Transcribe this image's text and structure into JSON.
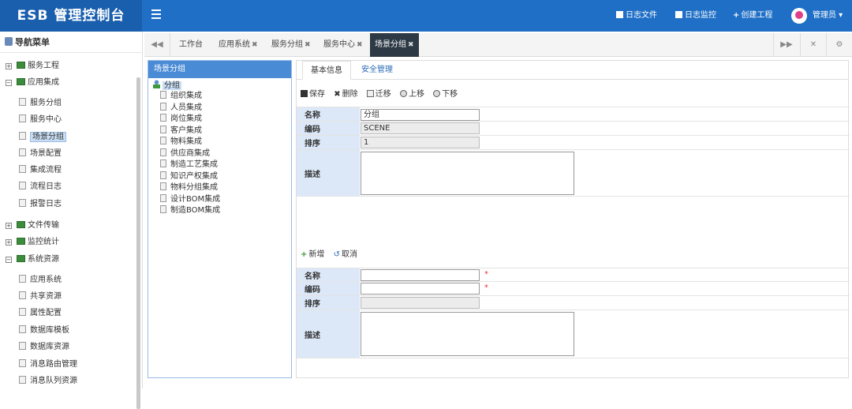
{
  "header": {
    "title": "ESB 管理控制台",
    "links": [
      "日志文件",
      "日志监控",
      "创建工程"
    ],
    "user": "管理员"
  },
  "sidebar": {
    "title": "导航菜单",
    "items": [
      {
        "label": "服务工程",
        "type": "group",
        "open": false
      },
      {
        "label": "应用集成",
        "type": "group",
        "open": true
      },
      {
        "label": "服务分组",
        "type": "leaf"
      },
      {
        "label": "服务中心",
        "type": "leaf"
      },
      {
        "label": "场景分组",
        "type": "leaf",
        "selected": true
      },
      {
        "label": "场景配置",
        "type": "leaf"
      },
      {
        "label": "集成流程",
        "type": "leaf"
      },
      {
        "label": "流程日志",
        "type": "leaf"
      },
      {
        "label": "报警日志",
        "type": "leaf"
      },
      {
        "label": "文件传输",
        "type": "group",
        "open": false
      },
      {
        "label": "监控统计",
        "type": "group",
        "open": false
      },
      {
        "label": "系统资源",
        "type": "group",
        "open": true
      },
      {
        "label": "应用系统",
        "type": "leaf"
      },
      {
        "label": "共享资源",
        "type": "leaf"
      },
      {
        "label": "属性配置",
        "type": "leaf"
      },
      {
        "label": "数据库模板",
        "type": "leaf"
      },
      {
        "label": "数据库资源",
        "type": "leaf"
      },
      {
        "label": "消息路由管理",
        "type": "leaf"
      },
      {
        "label": "消息队列资源",
        "type": "leaf"
      }
    ]
  },
  "tabs": [
    {
      "label": "工作台",
      "closable": false
    },
    {
      "label": "应用系统",
      "closable": true
    },
    {
      "label": "服务分组",
      "closable": true
    },
    {
      "label": "服务中心",
      "closable": true
    },
    {
      "label": "场景分组",
      "closable": true,
      "active": true
    }
  ],
  "tree": {
    "title": "场景分组",
    "root": "分组",
    "children": [
      "组织集成",
      "人员集成",
      "岗位集成",
      "客户集成",
      "物料集成",
      "供应商集成",
      "制造工艺集成",
      "知识产权集成",
      "物料分组集成",
      "设计BOM集成",
      "制造BOM集成"
    ]
  },
  "panel": {
    "tabs": [
      "基本信息",
      "安全管理"
    ],
    "toolbar1": [
      "保存",
      "删除",
      "迁移",
      "上移",
      "下移"
    ],
    "form1": {
      "name_label": "名称",
      "name_value": "分组",
      "code_label": "编码",
      "code_value": "SCENE",
      "order_label": "排序",
      "order_value": "1",
      "desc_label": "描述"
    },
    "toolbar2": [
      "新增",
      "取消"
    ],
    "form2": {
      "name_label": "名称",
      "code_label": "编码",
      "order_label": "排序",
      "desc_label": "描述",
      "required_mark": "*"
    }
  },
  "colors": {
    "header": "#1f6fc6",
    "logo": "#1a5fae",
    "active_tab": "#2d3a46",
    "label_bg": "#dce8f7"
  }
}
